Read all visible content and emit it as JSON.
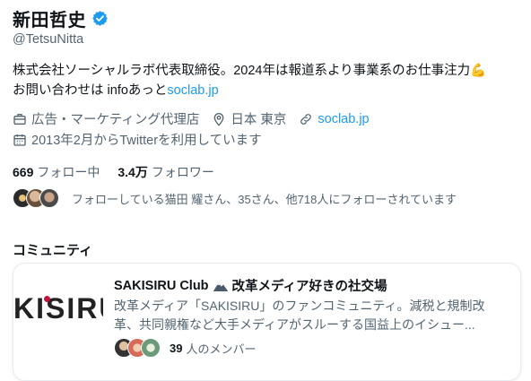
{
  "profile": {
    "name": "新田哲史",
    "handle": "@TetsuNitta",
    "bio_line1": "株式会社ソーシャルラボ代表取締役。2024年は報道系より事業系のお仕事注力💪",
    "bio_line2_prefix": "お問い合わせは infoあっと",
    "bio_line2_link": "soclab.jp",
    "category": "広告・マーケティング代理店",
    "location": "日本 東京",
    "website": "soclab.jp",
    "joined": "2013年2月からTwitterを利用しています"
  },
  "stats": {
    "following_count": "669",
    "following_label": "フォロー中",
    "followers_count": "3.4万",
    "followers_label": "フォロワー"
  },
  "followed_by": "フォローしている猫田 耀さん、35さん、他718人にフォローされています",
  "section": {
    "communities_title": "コミュニティ"
  },
  "community": {
    "logo_text": "KISIRU",
    "title_prefix": "SAKISIRU Club",
    "title_suffix": "改革メディア好きの社交場",
    "desc_line1": "改革メディア「SAKISIRU」のファンコミュニティ。減税と規制改",
    "desc_line2": "革、共同親権など大手メディアがスルーする国益上のイシュー...",
    "member_count": "39",
    "member_label": "人のメンバー"
  },
  "colors": {
    "link": "#1d9bf0",
    "verified": "#1d9bf0",
    "logo_accent": "#c0143c"
  },
  "icons": [
    "verified-badge-icon",
    "briefcase-icon",
    "location-pin-icon",
    "link-icon",
    "calendar-icon",
    "mountain-icon"
  ]
}
